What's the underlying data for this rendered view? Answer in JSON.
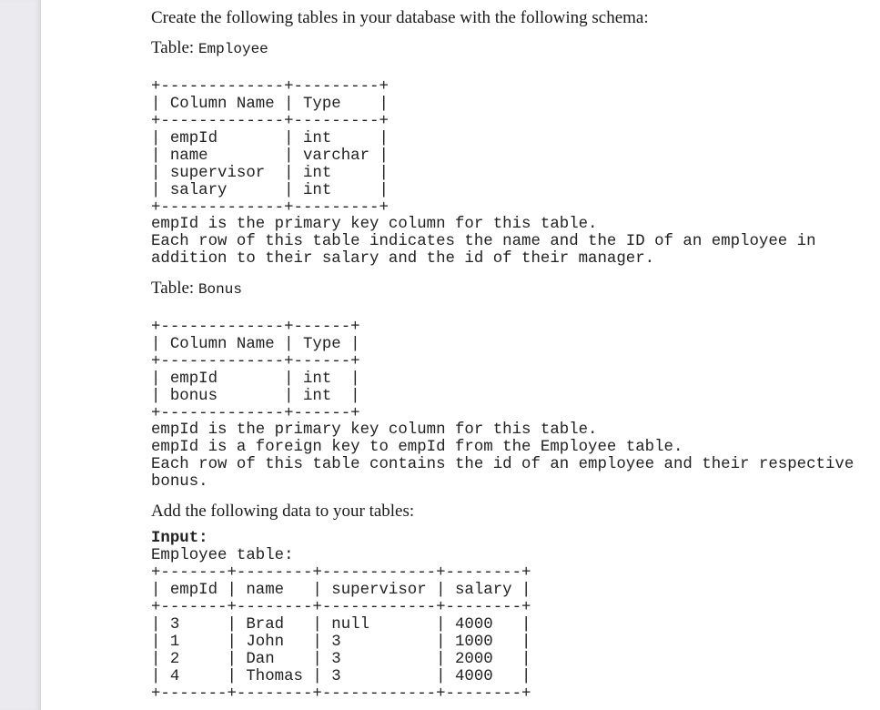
{
  "intro": {
    "heading": "Create the following tables in your database with the following schema:"
  },
  "employee_schema": {
    "label_prefix": "Table: ",
    "table_name": "Employee",
    "columns_header": [
      "Column Name",
      "Type"
    ],
    "rows": [
      [
        "empId",
        "int"
      ],
      [
        "name",
        "varchar"
      ],
      [
        "supervisor",
        "int"
      ],
      [
        "salary",
        "int"
      ]
    ],
    "notes": [
      "empId is the primary key column for this table.",
      "Each row of this table indicates the name and the ID of an employee in",
      "addition to their salary and the id of their manager."
    ]
  },
  "bonus_schema": {
    "label_prefix": "Table: ",
    "table_name": "Bonus",
    "columns_header": [
      "Column Name",
      "Type"
    ],
    "rows": [
      [
        "empId",
        "int"
      ],
      [
        "bonus",
        "int"
      ]
    ],
    "notes": [
      "empId is the primary key column for this table.",
      "empId is a foreign key to empId from the Employee table.",
      "Each row of this table contains the id of an employee and their respective",
      "bonus."
    ]
  },
  "data_section": {
    "heading": "Add the following data to your tables:",
    "input_label": "Input:",
    "employee_table_label": "Employee table:",
    "employee_data": {
      "headers": [
        "empId",
        "name",
        "supervisor",
        "salary"
      ],
      "rows": [
        [
          "3",
          "Brad",
          "null",
          "4000"
        ],
        [
          "1",
          "John",
          "3",
          "1000"
        ],
        [
          "2",
          "Dan",
          "3",
          "2000"
        ],
        [
          "4",
          "Thomas",
          "3",
          "4000"
        ]
      ]
    }
  }
}
